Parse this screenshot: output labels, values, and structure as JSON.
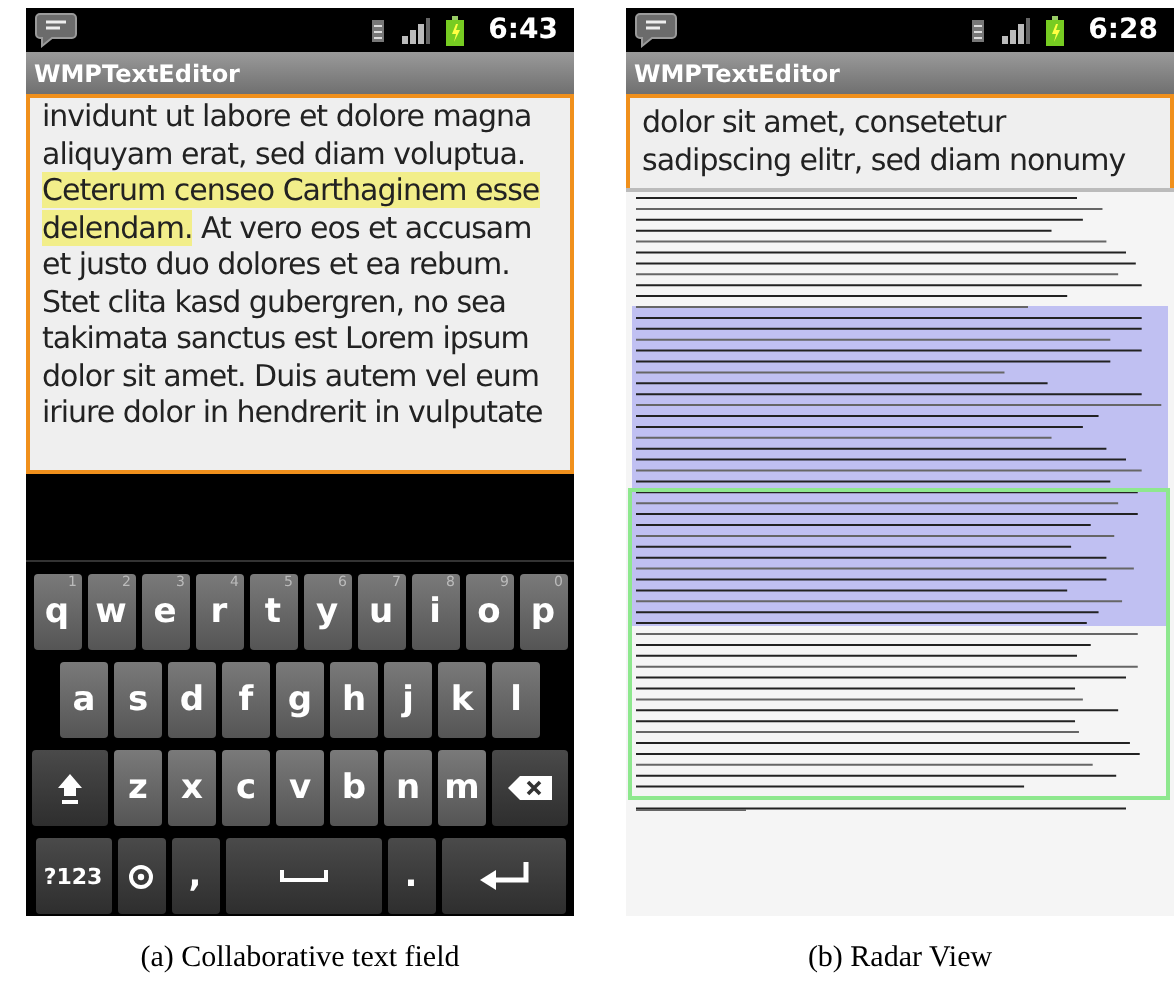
{
  "panels": [
    {
      "kind": "editor",
      "status_time": "6:43",
      "app_title": "WMPTextEditor",
      "text_segments": [
        {
          "text": "invidunt ut labore et dolore magna aliquyam erat, sed diam voluptua. ",
          "highlighted": false
        },
        {
          "text": "Ceterum censeo Carthaginem esse delendam.",
          "highlighted": true
        },
        {
          "text": " At vero eos et accusam et justo duo dolores et ea rebum. Stet clita kasd gubergren, no sea takimata sanctus est Lorem ipsum dolor sit amet. Duis autem vel eum iriure dolor in hendrerit in vulputate",
          "highlighted": false
        }
      ],
      "keyboard_rows": [
        [
          {
            "kind": "char",
            "label": "q",
            "hint": "1"
          },
          {
            "kind": "char",
            "label": "w",
            "hint": "2"
          },
          {
            "kind": "char",
            "label": "e",
            "hint": "3"
          },
          {
            "kind": "char",
            "label": "r",
            "hint": "4"
          },
          {
            "kind": "char",
            "label": "t",
            "hint": "5"
          },
          {
            "kind": "char",
            "label": "y",
            "hint": "6"
          },
          {
            "kind": "char",
            "label": "u",
            "hint": "7"
          },
          {
            "kind": "char",
            "label": "i",
            "hint": "8"
          },
          {
            "kind": "char",
            "label": "o",
            "hint": "9"
          },
          {
            "kind": "char",
            "label": "p",
            "hint": "0"
          }
        ],
        [
          {
            "kind": "char",
            "label": "a"
          },
          {
            "kind": "char",
            "label": "s"
          },
          {
            "kind": "char",
            "label": "d"
          },
          {
            "kind": "char",
            "label": "f"
          },
          {
            "kind": "char",
            "label": "g"
          },
          {
            "kind": "char",
            "label": "h"
          },
          {
            "kind": "char",
            "label": "j"
          },
          {
            "kind": "char",
            "label": "k"
          },
          {
            "kind": "char",
            "label": "l"
          }
        ],
        [
          {
            "kind": "shift"
          },
          {
            "kind": "char",
            "label": "z"
          },
          {
            "kind": "char",
            "label": "x"
          },
          {
            "kind": "char",
            "label": "c"
          },
          {
            "kind": "char",
            "label": "v"
          },
          {
            "kind": "char",
            "label": "b"
          },
          {
            "kind": "char",
            "label": "n"
          },
          {
            "kind": "char",
            "label": "m"
          },
          {
            "kind": "delete"
          }
        ],
        [
          {
            "kind": "symbols",
            "label": "?123"
          },
          {
            "kind": "settings"
          },
          {
            "kind": "punct",
            "label": ","
          },
          {
            "kind": "space"
          },
          {
            "kind": "punct",
            "label": "."
          },
          {
            "kind": "enter"
          }
        ]
      ],
      "caption": "(a) Collaborative text field"
    },
    {
      "kind": "radar",
      "status_time": "6:28",
      "app_title": "WMPTextEditor",
      "text_segments": [
        {
          "text": "dolor sit amet, consetetur sadipscing elitr, sed diam nonumy",
          "highlighted": false
        }
      ],
      "caption": "(b) Radar View"
    }
  ]
}
